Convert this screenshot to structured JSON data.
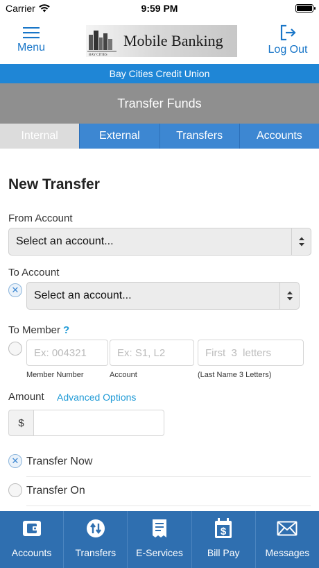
{
  "status_bar": {
    "carrier": "Carrier",
    "time": "9:59 PM"
  },
  "header": {
    "menu_label": "Menu",
    "logout_label": "Log Out",
    "logo_text": "Mobile Banking"
  },
  "banner": {
    "institution": "Bay Cities Credit Union"
  },
  "title_bar": {
    "title": "Transfer Funds"
  },
  "tabs": [
    {
      "label": "Internal"
    },
    {
      "label": "External"
    },
    {
      "label": "Transfers"
    },
    {
      "label": "Accounts"
    }
  ],
  "form": {
    "heading": "New Transfer",
    "from_account": {
      "label": "From Account",
      "value": "Select an account..."
    },
    "to_account": {
      "label": "To Account",
      "value": "Select an account..."
    },
    "to_member": {
      "label": "To Member",
      "help": "?",
      "member_number": {
        "placeholder": "Ex: 004321",
        "hint": "Member Number"
      },
      "account": {
        "placeholder": "Ex: S1, L2",
        "hint": "Account"
      },
      "last_name": {
        "placeholder": "First  3  letters",
        "hint": "(Last Name  3  Letters)"
      }
    },
    "amount": {
      "label": "Amount",
      "advanced_link": "Advanced Options",
      "currency_symbol": "$",
      "value": ""
    },
    "transfer_now_label": "Transfer Now",
    "transfer_on_label": "Transfer On"
  },
  "bottom_nav": [
    {
      "label": "Accounts",
      "icon": "wallet-icon"
    },
    {
      "label": "Transfers",
      "icon": "transfer-arrows-icon"
    },
    {
      "label": "E-Services",
      "icon": "document-icon"
    },
    {
      "label": "Bill Pay",
      "icon": "calendar-dollar-icon"
    },
    {
      "label": "Messages",
      "icon": "envelope-icon"
    }
  ],
  "colors": {
    "brand_blue": "#1f86d6",
    "tab_blue": "#3d87d2",
    "nav_blue": "#2f6fb0",
    "title_grey": "#8f8f8f",
    "link_blue": "#1976c8"
  }
}
